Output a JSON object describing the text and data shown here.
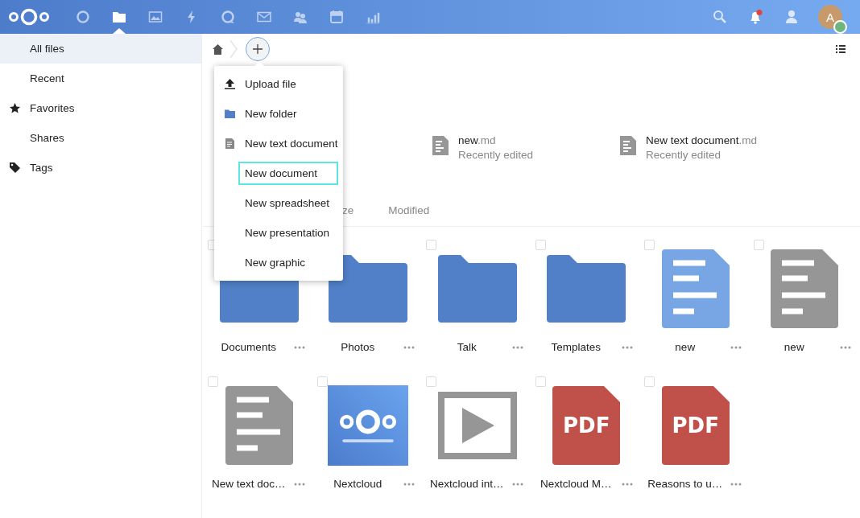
{
  "header": {
    "apps": [
      {
        "kind": "dashboard",
        "selected": false
      },
      {
        "kind": "files",
        "selected": true
      },
      {
        "kind": "photos",
        "selected": false
      },
      {
        "kind": "activity",
        "selected": false
      },
      {
        "kind": "talk",
        "selected": false
      },
      {
        "kind": "mail",
        "selected": false
      },
      {
        "kind": "contacts",
        "selected": false
      },
      {
        "kind": "calendar",
        "selected": false
      },
      {
        "kind": "stats",
        "selected": false
      }
    ],
    "notifications_unread": true,
    "avatar": {
      "letter": "A"
    }
  },
  "sidebar": {
    "items": [
      {
        "label": "All files",
        "kind": "plain",
        "selected": true
      },
      {
        "label": "Recent",
        "kind": "plain",
        "selected": false
      },
      {
        "label": "Favorites",
        "kind": "star",
        "selected": false
      },
      {
        "label": "Shares",
        "kind": "plain",
        "selected": false
      },
      {
        "label": "Tags",
        "kind": "tag",
        "selected": false
      }
    ]
  },
  "new_menu": {
    "items": [
      {
        "label": "Upload file",
        "kind": "upload",
        "highlighted": false
      },
      {
        "label": "New folder",
        "kind": "folder",
        "highlighted": false
      },
      {
        "label": "New text document",
        "kind": "text",
        "highlighted": false
      },
      {
        "label": "New document",
        "kind": "plain",
        "highlighted": true
      },
      {
        "label": "New spreadsheet",
        "kind": "plain",
        "highlighted": false
      },
      {
        "label": "New presentation",
        "kind": "plain",
        "highlighted": false
      },
      {
        "label": "New graphic",
        "kind": "plain",
        "highlighted": false
      }
    ]
  },
  "recent": [
    {
      "name": "new",
      "extension": ".md",
      "note": "Recently edited"
    },
    {
      "name": "New text document",
      "extension": ".md",
      "note": "Recently edited"
    }
  ],
  "sort_columns": [
    "ze",
    "Modified"
  ],
  "files": [
    {
      "name": "Documents",
      "kind": "folder",
      "checked": false
    },
    {
      "name": "Photos",
      "kind": "folder"
    },
    {
      "name": "Talk",
      "kind": "folder",
      "checked": false
    },
    {
      "name": "Templates",
      "kind": "folder",
      "checked": false
    },
    {
      "name": "new",
      "kind": "doc-blue",
      "checked": false
    },
    {
      "name": "new",
      "kind": "doc-grey",
      "checked": false
    },
    {
      "name": "New text doc…",
      "kind": "doc-grey",
      "checked": false
    },
    {
      "name": "Nextcloud",
      "kind": "picture",
      "checked": false
    },
    {
      "name": "Nextcloud int…",
      "kind": "video",
      "checked": false
    },
    {
      "name": "Nextcloud M…",
      "kind": "pdf",
      "icon_label": "PDF",
      "checked": false
    },
    {
      "name": "Reasons to u…",
      "kind": "pdf",
      "icon_label": "PDF",
      "checked": false
    }
  ]
}
